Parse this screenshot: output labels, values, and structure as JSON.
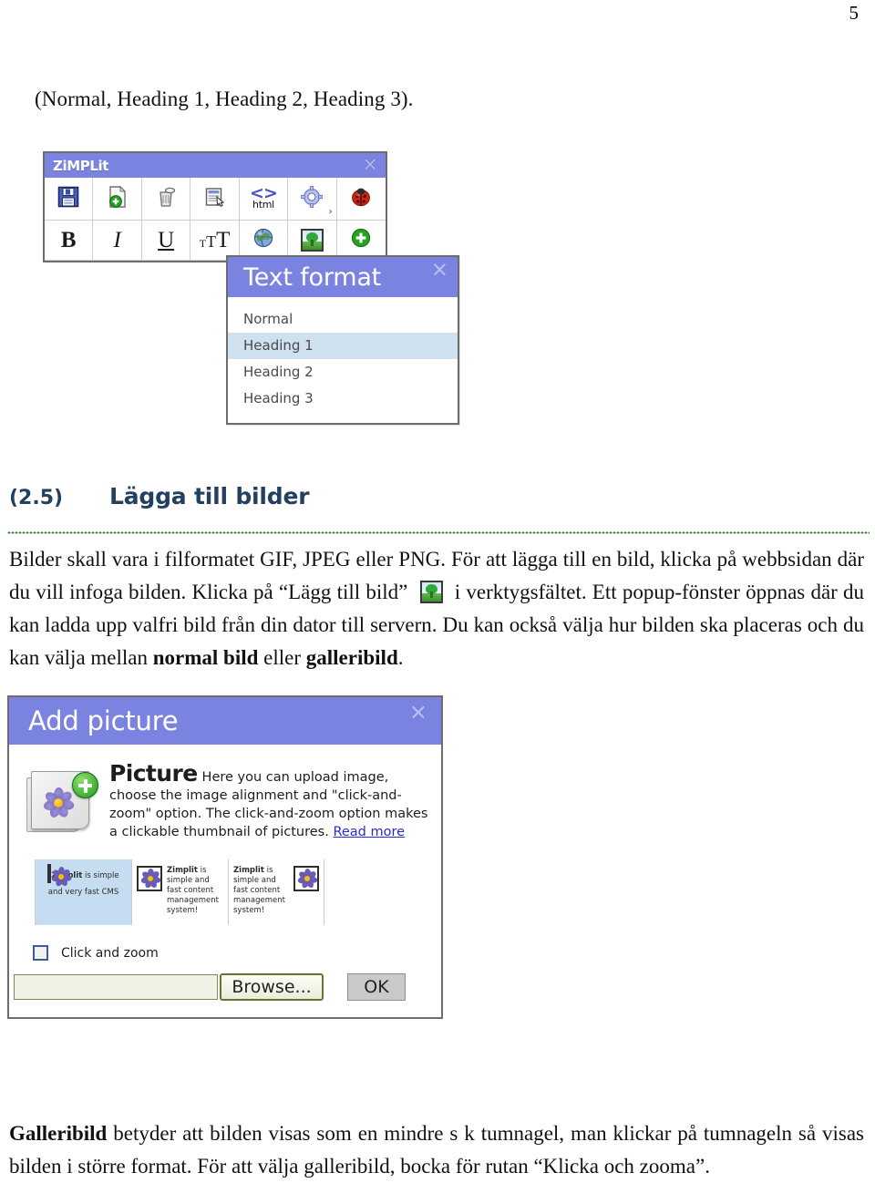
{
  "page": {
    "number": "5",
    "intro_line": "(Normal, Heading 1, Heading 2, Heading 3)."
  },
  "colors": {
    "window_titlebar": "#7b83e0",
    "heading_navy": "#23415e",
    "rule_green": "#3f7d3f",
    "selection_blue": "#c6dcf0",
    "link_blue": "#2a2ad0"
  },
  "zimplit_toolbar": {
    "title": "ZiMPLit",
    "close_label": "×",
    "row_one": [
      {
        "name": "save-icon",
        "tooltip": "Save"
      },
      {
        "name": "new-page-icon",
        "tooltip": "New page"
      },
      {
        "name": "trash-icon",
        "tooltip": "Delete page"
      },
      {
        "name": "template-icon",
        "tooltip": "Select template"
      },
      {
        "name": "html-icon",
        "label": "html",
        "glyph": "<>"
      },
      {
        "name": "settings-gear-icon",
        "chevron": "›"
      },
      {
        "name": "ladybug-icon",
        "tooltip": "Bug"
      }
    ],
    "row_two": [
      {
        "name": "bold-button",
        "label": "B"
      },
      {
        "name": "italic-button",
        "label": "I"
      },
      {
        "name": "underline-button",
        "label": "U"
      },
      {
        "name": "text-size-button",
        "small": "T",
        "medium": "T",
        "large": "T"
      },
      {
        "name": "link-globe-icon",
        "tooltip": "Insert link"
      },
      {
        "name": "add-picture-icon",
        "tooltip": "Lägg till bild"
      },
      {
        "name": "add-element-icon",
        "tooltip": "Add"
      }
    ]
  },
  "text_format_panel": {
    "title": "Text format",
    "close_label": "×",
    "items": [
      {
        "label": "Normal",
        "selected": false
      },
      {
        "label": "Heading 1",
        "selected": true
      },
      {
        "label": "Heading 2",
        "selected": false
      },
      {
        "label": "Heading 3",
        "selected": false
      }
    ]
  },
  "section": {
    "number": "(2.5)",
    "title": "Lägga till bilder"
  },
  "paragraphs": {
    "one_part_a": "Bilder skall vara i filformatet GIF, JPEG eller PNG.  För att lägga till en bild, klicka på webbsidan där du vill infoga bilden. Klicka på “Lägg till bild”",
    "one_part_b": "i verktygsfältet. Ett popup-fönster öppnas där du kan ladda upp valfri bild från din dator till servern. Du kan också välja hur bilden ska placeras och du kan välja mellan",
    "one_bold_one": "normal bild",
    "one_mid": "eller",
    "one_bold_two": "galleribild",
    "one_end": ".",
    "two_bold": "Galleribild",
    "two_rest": "betyder att bilden visas som en mindre s k tumnagel, man klickar på tumnageln så visas bilden i större format. För att välja galleribild, bocka för rutan “Klicka och zooma”."
  },
  "add_picture_dialog": {
    "title": "Add picture",
    "close_label": "×",
    "icon_name": "picture-flower-add-icon",
    "info_heading": "Picture",
    "info_text": "Here you can upload image, choose the image alignment and \"click-and-zoom\" option. The click-and-zoom option makes a clickable thumbnail of pictures.",
    "read_more_label": "Read more",
    "alignment_options": [
      {
        "layout": "center",
        "selected": true,
        "caption_bold": "Zimplit",
        "caption_rest": "is simple and very fast CMS"
      },
      {
        "layout": "left",
        "selected": false,
        "caption_bold": "Zimplit",
        "caption_rest": "is simple and fast content management system!"
      },
      {
        "layout": "right",
        "selected": false,
        "caption_bold": "Zimplit",
        "caption_rest": "is simple and fast content management system!"
      }
    ],
    "click_and_zoom": {
      "label": "Click and zoom",
      "checked": false
    },
    "file_field_value": "",
    "file_field_placeholder": "",
    "browse_label": "Browse...",
    "ok_label": "OK"
  }
}
